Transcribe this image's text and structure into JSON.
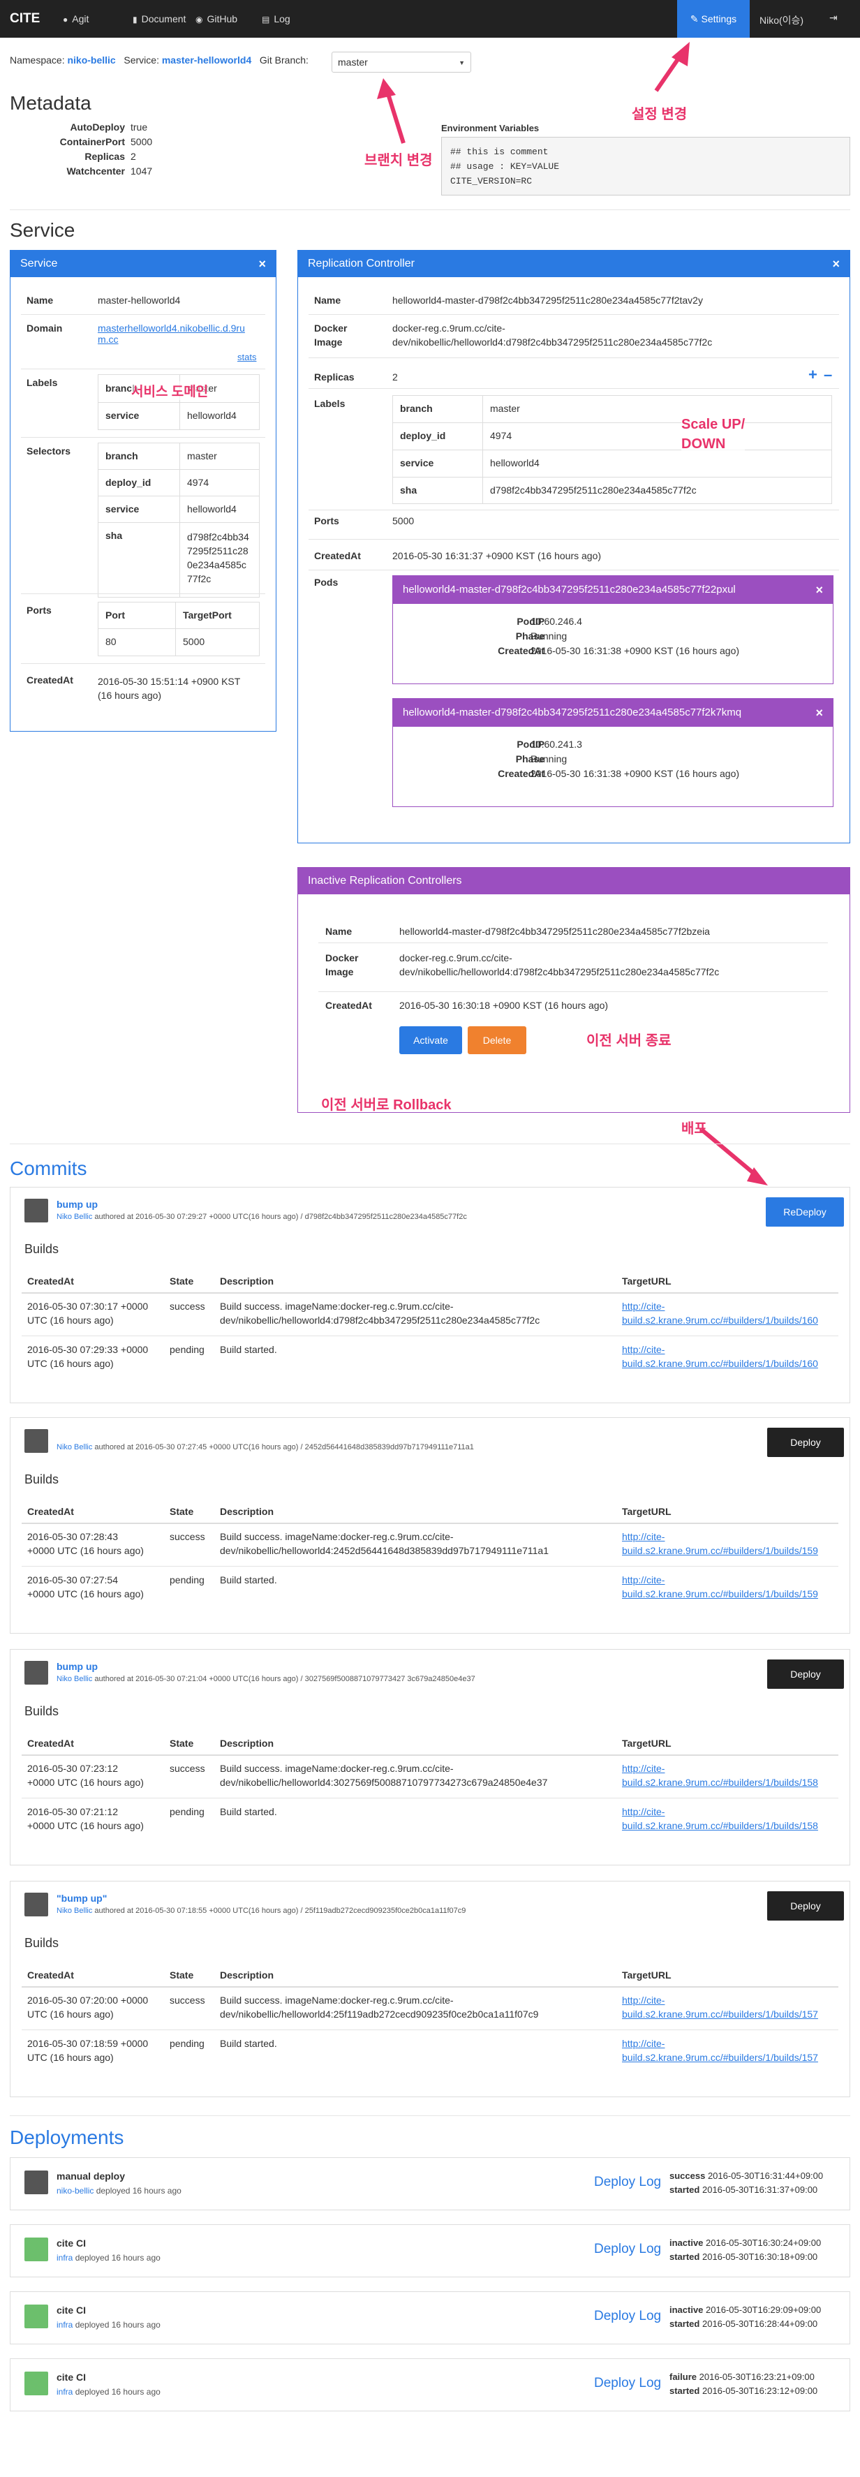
{
  "nav": {
    "brand": "CITE",
    "items": [
      "Agit",
      "Document",
      "GitHub",
      "Log"
    ],
    "settings": "Settings",
    "user": "Niko(이승)",
    "logout_icon": "sign-out-icon"
  },
  "ns": {
    "ns_label": "Namespace:",
    "ns_value": "niko-bellic",
    "svc_label": "Service:",
    "svc_value": "master-helloworld4",
    "branch_label": "Git Branch:",
    "branch_value": "master"
  },
  "meta": {
    "title": "Metadata",
    "rows": [
      {
        "k": "AutoDeploy",
        "v": "true"
      },
      {
        "k": "ContainerPort",
        "v": "5000"
      },
      {
        "k": "Replicas",
        "v": "2"
      },
      {
        "k": "Watchcenter",
        "v": "1047"
      }
    ],
    "env_title": "Environment Variables",
    "env_lines": [
      "## this is comment",
      "## usage : KEY=VALUE",
      "CITE_VERSION=RC"
    ]
  },
  "annotations": {
    "settings": "설정 변경",
    "branch": "브랜치 변경",
    "domain": "서비스 도메인",
    "scale": "Scale UP/",
    "scale2": "DOWN",
    "delete": "이전 서버 종료",
    "rollback": "이전 서버로 Rollback",
    "deploy": "배포"
  },
  "service": {
    "section_title": "Service",
    "panel_title": "Service",
    "name_k": "Name",
    "name_v": "master-helloworld4",
    "domain_k": "Domain",
    "domain_v1": "masterhelloworld4.nikobellic.d.9ru",
    "domain_v2": "m.cc",
    "stats": "stats",
    "labels_k": "Labels",
    "labels": [
      {
        "k": "branch",
        "v": "master"
      },
      {
        "k": "service",
        "v": "helloworld4"
      }
    ],
    "selectors_k": "Selectors",
    "selectors": [
      {
        "k": "branch",
        "v": "master"
      },
      {
        "k": "deploy_id",
        "v": "4974"
      },
      {
        "k": "service",
        "v": "helloworld4"
      },
      {
        "k": "sha",
        "v1": "d798f2c4bb34",
        "v2": "7295f2511c28",
        "v3": "0e234a4585c",
        "v4": "77f2c"
      }
    ],
    "ports_k": "Ports",
    "ports_head": [
      "Port",
      "TargetPort"
    ],
    "ports_row": [
      "80",
      "5000"
    ],
    "created_k": "CreatedAt",
    "created_v1": "2016-05-30 15:51:14 +0900 KST",
    "created_v2": "(16 hours ago)"
  },
  "rc": {
    "panel_title": "Replication Controller",
    "name_k": "Name",
    "name_v": "helloworld4-master-d798f2c4bb347295f2511c280e234a4585c77f2tav2y",
    "image_k1": "Docker",
    "image_k2": "Image",
    "image_v1": "docker-reg.c.9rum.cc/cite-",
    "image_v2": "dev/nikobellic/helloworld4:d798f2c4bb347295f2511c280e234a4585c77f2c",
    "replicas_k": "Replicas",
    "replicas_v": "2",
    "plus": "+",
    "minus": "–",
    "labels_k": "Labels",
    "labels": [
      {
        "k": "branch",
        "v": "master"
      },
      {
        "k": "deploy_id",
        "v": "4974"
      },
      {
        "k": "service",
        "v": "helloworld4"
      },
      {
        "k": "sha",
        "v": "d798f2c4bb347295f2511c280e234a4585c77f2c"
      }
    ],
    "ports_k": "Ports",
    "ports_v": "5000",
    "created_k": "CreatedAt",
    "created_v": "2016-05-30 16:31:37 +0900 KST (16 hours ago)",
    "pods_k": "Pods",
    "pods": [
      {
        "title": "helloworld4-master-d798f2c4bb347295f2511c280e234a4585c77f22pxul",
        "ip": "10.60.246.4",
        "phase": "Running",
        "created": "2016-05-30 16:31:38 +0900 KST (16 hours ago)"
      },
      {
        "title": "helloworld4-master-d798f2c4bb347295f2511c280e234a4585c77f2k7kmq",
        "ip": "10.60.241.3",
        "phase": "Running",
        "created": "2016-05-30 16:31:38 +0900 KST (16 hours ago)"
      }
    ],
    "pod_keys": [
      "PodIP",
      "Phase",
      "CreatedAt"
    ]
  },
  "irc": {
    "panel_title": "Inactive Replication Controllers",
    "name_k": "Name",
    "name_v": "helloworld4-master-d798f2c4bb347295f2511c280e234a4585c77f2bzeia",
    "image_k1": "Docker",
    "image_k2": "Image",
    "image_v1": "docker-reg.c.9rum.cc/cite-",
    "image_v2": "dev/nikobellic/helloworld4:d798f2c4bb347295f2511c280e234a4585c77f2c",
    "created_k": "CreatedAt",
    "created_v": "2016-05-30 16:30:18 +0900 KST (16 hours ago)",
    "activate": "Activate",
    "delete": "Delete"
  },
  "commits": {
    "title": "Commits",
    "builds_title": "Builds",
    "head": [
      "CreatedAt",
      "State",
      "Description",
      "TargetURL"
    ],
    "list": [
      {
        "title": "bump up",
        "author": "Niko Bellic",
        "meta": "authored at 2016-05-30 07:29:27 +0000 UTC(16 hours ago) / d798f2c4bb347295f2511c280e234a4585c77f2c",
        "button": "ReDeploy",
        "builds": [
          {
            "c1": "2016-05-30 07:30:17 +0000",
            "c2": "UTC (16 hours ago)",
            "state": "success",
            "d1": "Build success. imageName:docker-reg.c.9rum.cc/cite-",
            "d2": "dev/nikobellic/helloworld4:d798f2c4bb347295f2511c280e234a4585c77f2c",
            "u1": "http://cite-",
            "u2": "build.s2.krane.9rum.cc/#builders/1/builds/160"
          },
          {
            "c1": "2016-05-30 07:29:33 +0000",
            "c2": "UTC (16 hours ago)",
            "state": "pending",
            "d1": "Build started.",
            "d2": "",
            "u1": "http://cite-",
            "u2": "build.s2.krane.9rum.cc/#builders/1/builds/160"
          }
        ]
      },
      {
        "title": "",
        "author": "Niko Bellic",
        "meta": "authored at 2016-05-30 07:27:45 +0000 UTC(16 hours ago) / 2452d56441648d385839dd97b717949111e711a1",
        "button": "Deploy",
        "builds": [
          {
            "c1": "2016-05-30 07:28:43",
            "c2": "+0000 UTC (16 hours ago)",
            "state": "success",
            "d1": "Build success. imageName:docker-reg.c.9rum.cc/cite-",
            "d2": "dev/nikobellic/helloworld4:2452d56441648d385839dd97b717949111e711a1",
            "u1": "http://cite-",
            "u2": "build.s2.krane.9rum.cc/#builders/1/builds/159"
          },
          {
            "c1": "2016-05-30 07:27:54",
            "c2": "+0000 UTC (16 hours ago)",
            "state": "pending",
            "d1": "Build started.",
            "d2": "",
            "u1": "http://cite-",
            "u2": "build.s2.krane.9rum.cc/#builders/1/builds/159"
          }
        ]
      },
      {
        "title": "bump up",
        "author": "Niko Bellic",
        "meta": "authored at 2016-05-30 07:21:04 +0000 UTC(16 hours ago) / 3027569f5008871079773427 3c679a24850e4e37",
        "button": "Deploy",
        "builds": [
          {
            "c1": "2016-05-30 07:23:12",
            "c2": "+0000 UTC (16 hours ago)",
            "state": "success",
            "d1": "Build success. imageName:docker-reg.c.9rum.cc/cite-",
            "d2": "dev/nikobellic/helloworld4:3027569f50088710797734273c679a24850e4e37",
            "u1": "http://cite-",
            "u2": "build.s2.krane.9rum.cc/#builders/1/builds/158"
          },
          {
            "c1": "2016-05-30 07:21:12",
            "c2": "+0000 UTC (16 hours ago)",
            "state": "pending",
            "d1": "Build started.",
            "d2": "",
            "u1": "http://cite-",
            "u2": "build.s2.krane.9rum.cc/#builders/1/builds/158"
          }
        ]
      },
      {
        "title": "\"bump up\"",
        "author": "Niko Bellic",
        "meta": "authored at 2016-05-30 07:18:55 +0000 UTC(16 hours ago) / 25f119adb272cecd909235f0ce2b0ca1a11f07c9",
        "button": "Deploy",
        "builds": [
          {
            "c1": "2016-05-30 07:20:00 +0000",
            "c2": "UTC (16 hours ago)",
            "state": "success",
            "d1": "Build success. imageName:docker-reg.c.9rum.cc/cite-",
            "d2": "dev/nikobellic/helloworld4:25f119adb272cecd909235f0ce2b0ca1a11f07c9",
            "u1": "http://cite-",
            "u2": "build.s2.krane.9rum.cc/#builders/1/builds/157"
          },
          {
            "c1": "2016-05-30 07:18:59 +0000",
            "c2": "UTC (16 hours ago)",
            "state": "pending",
            "d1": "Build started.",
            "d2": "",
            "u1": "http://cite-",
            "u2": "build.s2.krane.9rum.cc/#builders/1/builds/157"
          }
        ]
      }
    ]
  },
  "deployments": {
    "title": "Deployments",
    "log_label": "Deploy Log",
    "list": [
      {
        "title": "manual deploy",
        "user": "niko-bellic",
        "ago": "deployed 16 hours ago",
        "s1": "success",
        "t1": "2016-05-30T16:31:44+09:00",
        "s2": "started",
        "t2": "2016-05-30T16:31:37+09:00"
      },
      {
        "title": "cite CI",
        "user": "infra",
        "ago": "deployed 16 hours ago",
        "s1": "inactive",
        "t1": "2016-05-30T16:30:24+09:00",
        "s2": "started",
        "t2": "2016-05-30T16:30:18+09:00"
      },
      {
        "title": "cite CI",
        "user": "infra",
        "ago": "deployed 16 hours ago",
        "s1": "inactive",
        "t1": "2016-05-30T16:29:09+09:00",
        "s2": "started",
        "t2": "2016-05-30T16:28:44+09:00"
      },
      {
        "title": "cite CI",
        "user": "infra",
        "ago": "deployed 16 hours ago",
        "s1": "failure",
        "t1": "2016-05-30T16:23:21+09:00",
        "s2": "started",
        "t2": "2016-05-30T16:23:12+09:00"
      }
    ]
  },
  "colors": {
    "primary": "#2a7ae2",
    "purple": "#9b4fc0",
    "orange": "#f0812e",
    "annotation": "#e8336a",
    "dark": "#222222"
  }
}
